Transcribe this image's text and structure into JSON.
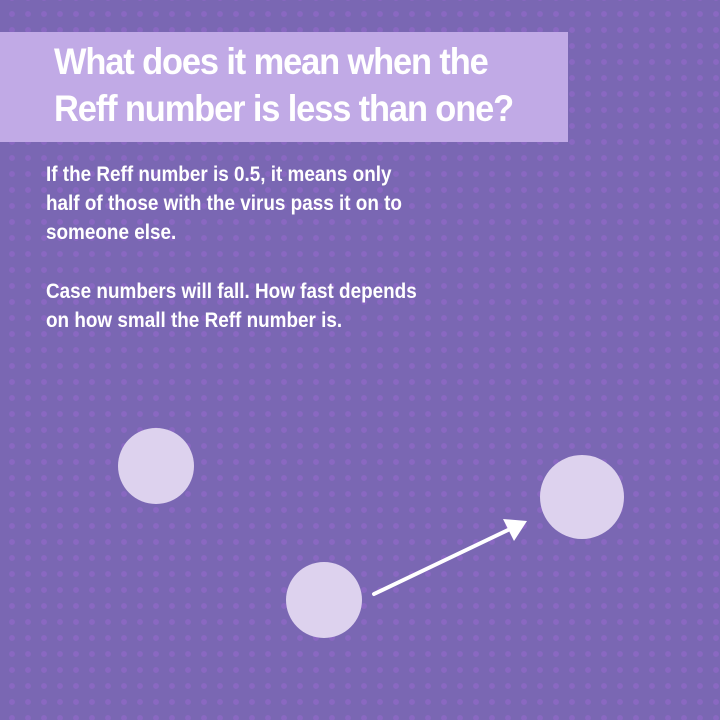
{
  "title": {
    "line1": "What does it mean when the",
    "line2": "Reff number is less than one?"
  },
  "paragraphs": [
    {
      "lines": [
        "If the Reff number is 0.5, it means only",
        "half of those with the virus pass it on to",
        "someone else."
      ]
    },
    {
      "lines": [
        "Case numbers will fall. How fast depends",
        "on how small the Reff number is."
      ]
    }
  ],
  "diagram": {
    "person_color": "#ddd2ee",
    "arrow_color": "#ffffff",
    "nodes": [
      "person-unlinked",
      "person-source",
      "person-infected"
    ],
    "edges": [
      {
        "from": "person-source",
        "to": "person-infected"
      }
    ]
  }
}
